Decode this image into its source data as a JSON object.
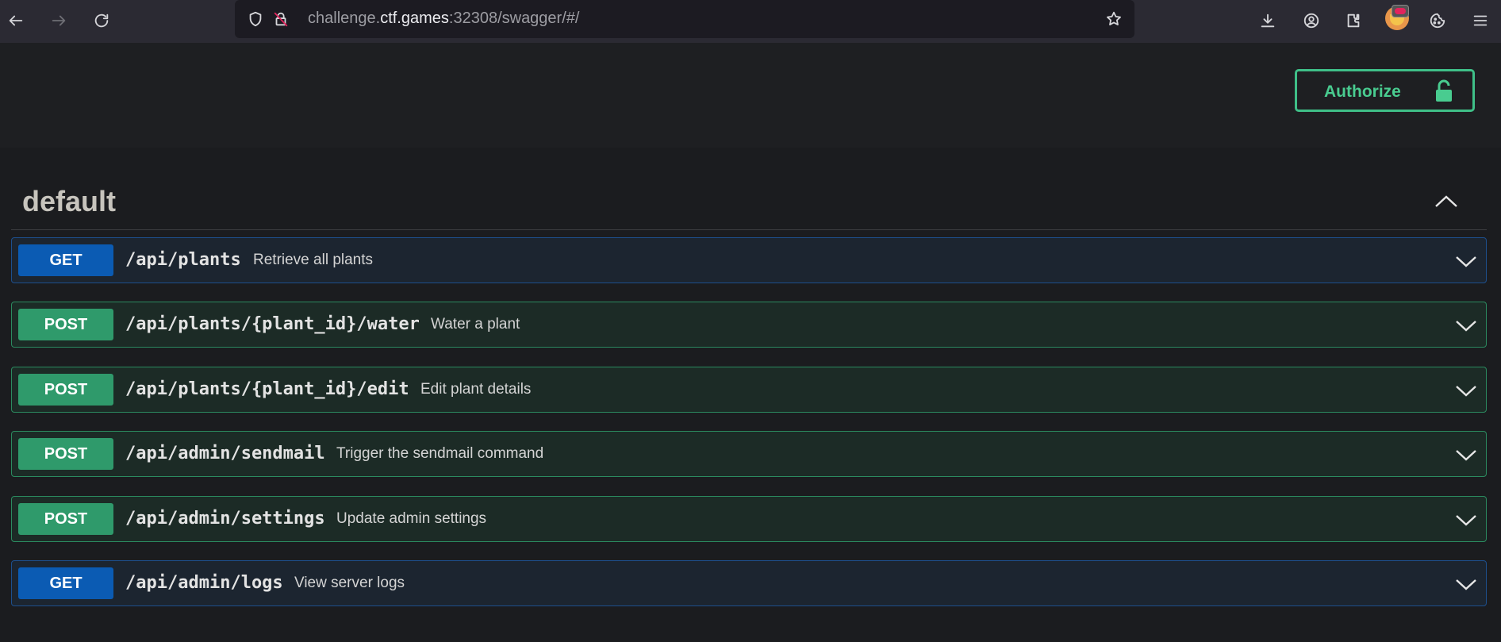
{
  "browser": {
    "url_prefix": "challenge.",
    "url_host": "ctf.games",
    "url_suffix": ":32308/swagger/#/"
  },
  "header": {
    "authorize_label": "Authorize"
  },
  "section": {
    "title": "default"
  },
  "operations": [
    {
      "method": "GET",
      "path": "/api/plants",
      "summary": "Retrieve all plants"
    },
    {
      "method": "POST",
      "path": "/api/plants/{plant_id}/water",
      "summary": "Water a plant"
    },
    {
      "method": "POST",
      "path": "/api/plants/{plant_id}/edit",
      "summary": "Edit plant details"
    },
    {
      "method": "POST",
      "path": "/api/admin/sendmail",
      "summary": "Trigger the sendmail command"
    },
    {
      "method": "POST",
      "path": "/api/admin/settings",
      "summary": "Update admin settings"
    },
    {
      "method": "GET",
      "path": "/api/admin/logs",
      "summary": "View server logs"
    }
  ],
  "colors": {
    "get": "#0b5bb3",
    "post": "#2f9a6b",
    "authorize": "#49cc90"
  },
  "icons": [
    "back-icon",
    "forward-icon",
    "reload-icon",
    "shield-icon",
    "insecure-lock-icon",
    "star-icon",
    "download-icon",
    "account-icon",
    "extensions-icon",
    "cookie-icon",
    "menu-icon",
    "lock-icon",
    "chevron-up-icon",
    "chevron-down-icon"
  ]
}
